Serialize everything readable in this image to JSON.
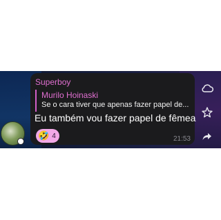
{
  "message": {
    "sender": "Superboy",
    "reply": {
      "name": "Murilo Hoinaski",
      "text": "Se o cara tiver que apenas fazer papel de..."
    },
    "text": "Eu também vou fazer papel de fêmea",
    "reaction": {
      "emoji": "🤣",
      "count": "4"
    },
    "time": "21:53"
  },
  "actions": {
    "icons": [
      "cloud-icon",
      "star-icon",
      "share-icon"
    ]
  },
  "colors": {
    "bubble": "#1b1b1d",
    "sender": "#e06fd0",
    "reaction_bg": "#f2a8e7"
  }
}
